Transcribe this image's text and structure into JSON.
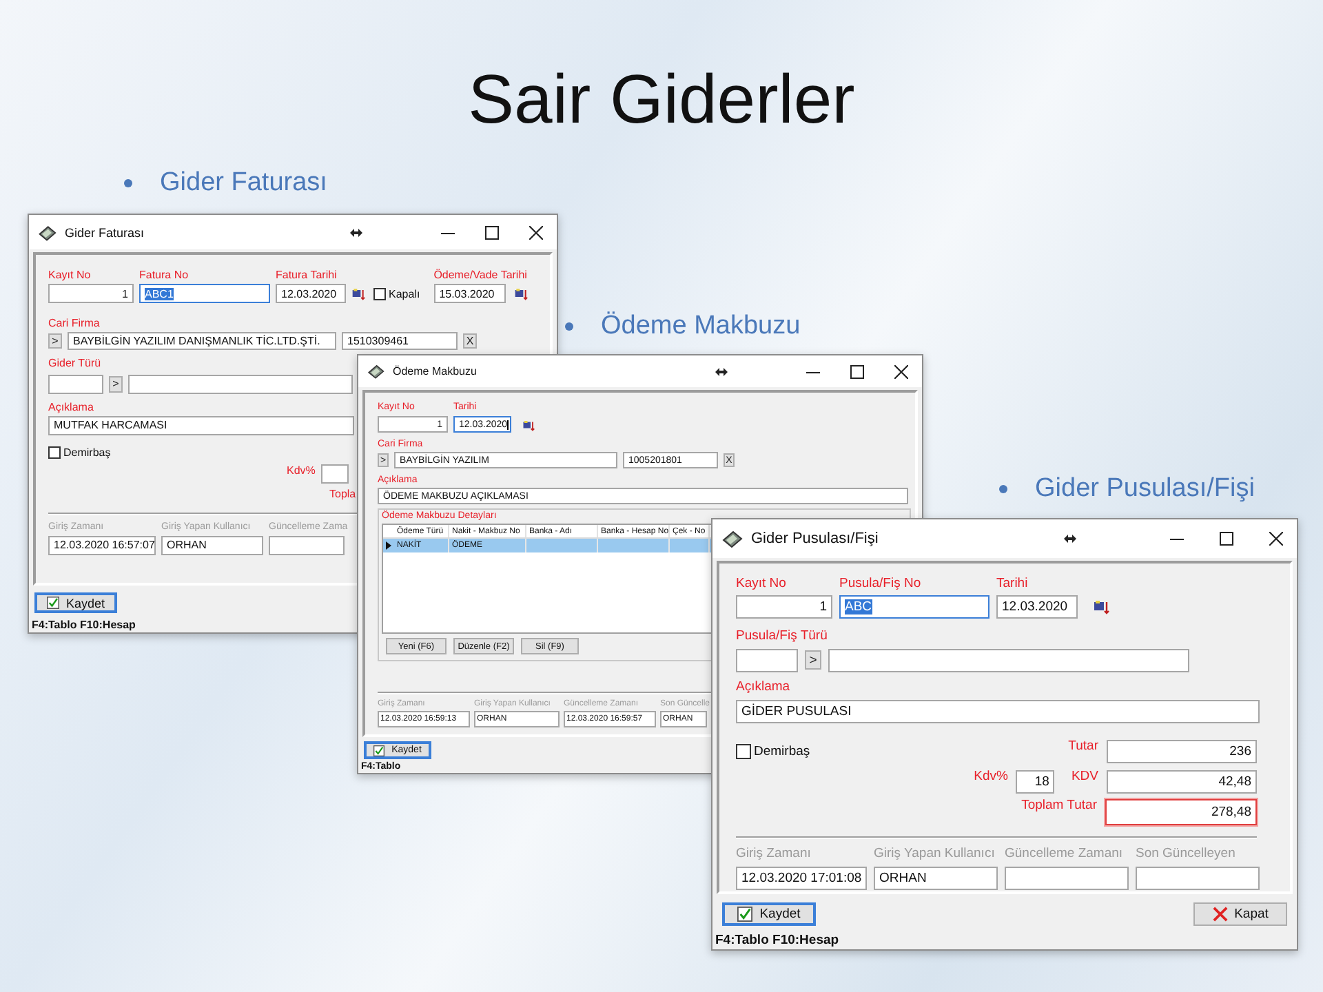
{
  "slide": {
    "title": "Sair Giderler",
    "bullets": [
      {
        "text": "Gider Faturası"
      },
      {
        "text": "Ödeme Makbuzu"
      },
      {
        "text": "Gider Pusulası/Fişi"
      }
    ]
  },
  "gider_faturasi": {
    "title": "Gider Faturası",
    "kayit_no": {
      "label": "Kayıt No",
      "value": "1"
    },
    "fatura_no": {
      "label": "Fatura No",
      "value": "ABC1",
      "focused": true,
      "text_selected": true
    },
    "fatura_tarihi": {
      "label": "Fatura Tarihi",
      "value": "12.03.2020"
    },
    "kapali": {
      "label": "Kapalı",
      "checked": false
    },
    "vade_tarihi": {
      "label": "Ödeme/Vade Tarihi",
      "value": "15.03.2020"
    },
    "cari_firma": {
      "label": "Cari Firma",
      "picker": ">",
      "name": "BAYBİLGİN YAZILIM DANIŞMANLIK TİC.LTD.ŞTİ.",
      "code": "1510309461",
      "clear": "X"
    },
    "gider_turu": {
      "label": "Gider Türü",
      "picker": ">"
    },
    "aciklama": {
      "label": "Açıklama",
      "value": "MUTFAK HARCAMASI"
    },
    "demirbas": {
      "label": "Demirbaş",
      "checked": false
    },
    "kdv_label": "Kdv%",
    "toplam_label": "Topla",
    "audit": [
      {
        "label": "Giriş Zamanı",
        "value": "12.03.2020 16:57:07"
      },
      {
        "label": "Giriş Yapan Kullanıcı",
        "value": "ORHAN"
      },
      {
        "label": "Güncelleme Zama"
      }
    ],
    "save_button": "Kaydet",
    "status_bar": "F4:Tablo F10:Hesap"
  },
  "odeme_makbuzu": {
    "title": "Ödeme Makbuzu",
    "kayit_no": {
      "label": "Kayıt No",
      "value": "1"
    },
    "tarihi": {
      "label": "Tarihi",
      "value": "12.03.2020",
      "focused": true,
      "text_selected": false
    },
    "cari_firma": {
      "label": "Cari Firma",
      "picker": ">",
      "name": "BAYBİLGİN YAZILIM",
      "code": "1005201801",
      "clear": "X"
    },
    "aciklama": {
      "label": "Açıklama",
      "value": "ÖDEME MAKBUZU AÇIKLAMASI"
    },
    "details": {
      "title": "Ödeme Makbuzu Detayları",
      "columns": [
        "Ödeme Türü",
        "Nakit - Makbuz No",
        "Banka - Adı",
        "Banka - Hesap No",
        "Çek - No"
      ],
      "rows": [
        {
          "cells": [
            "NAKİT",
            "ÖDEME"
          ],
          "selected": true
        }
      ],
      "buttons": [
        "Yeni (F6)",
        "Düzenle (F2)",
        "Sil (F9)"
      ]
    },
    "audit": [
      {
        "label": "Giriş Zamanı",
        "value": "12.03.2020 16:59:13"
      },
      {
        "label": "Giriş Yapan Kullanıcı",
        "value": "ORHAN"
      },
      {
        "label": "Güncelleme Zamanı",
        "value": "12.03.2020 16:59:57"
      },
      {
        "label": "Son Güncelle",
        "value": "ORHAN"
      }
    ],
    "save_button": "Kaydet",
    "status_bar": "F4:Tablo"
  },
  "gider_pusulasi": {
    "title": "Gider Pusulası/Fişi",
    "kayit_no": {
      "label": "Kayıt No",
      "value": "1"
    },
    "pusula_no": {
      "label": "Pusula/Fiş No",
      "value": "ABC",
      "focused": true,
      "text_selected": true
    },
    "tarihi": {
      "label": "Tarihi",
      "value": "12.03.2020"
    },
    "turu": {
      "label": "Pusula/Fiş Türü",
      "picker": ">"
    },
    "aciklama": {
      "label": "Açıklama",
      "value": "GİDER PUSULASI"
    },
    "demirbas": {
      "label": "Demirbaş",
      "checked": false
    },
    "tutar": {
      "label": "Tutar",
      "value": "236"
    },
    "kdv_orani": {
      "label": "Kdv%",
      "value": "18"
    },
    "kdv": {
      "label": "KDV",
      "value": "42,48"
    },
    "toplam": {
      "label": "Toplam Tutar",
      "value": "278,48",
      "outlined": true
    },
    "audit": [
      {
        "label": "Giriş Zamanı",
        "value": "12.03.2020 17:01:08"
      },
      {
        "label": "Giriş Yapan Kullanıcı",
        "value": "ORHAN"
      },
      {
        "label": "Güncelleme Zamanı"
      },
      {
        "label": "Son Güncelleyen"
      }
    ],
    "save_button": "Kaydet",
    "close_button": "Kapat",
    "status_bar": "F4:Tablo F10:Hesap"
  }
}
